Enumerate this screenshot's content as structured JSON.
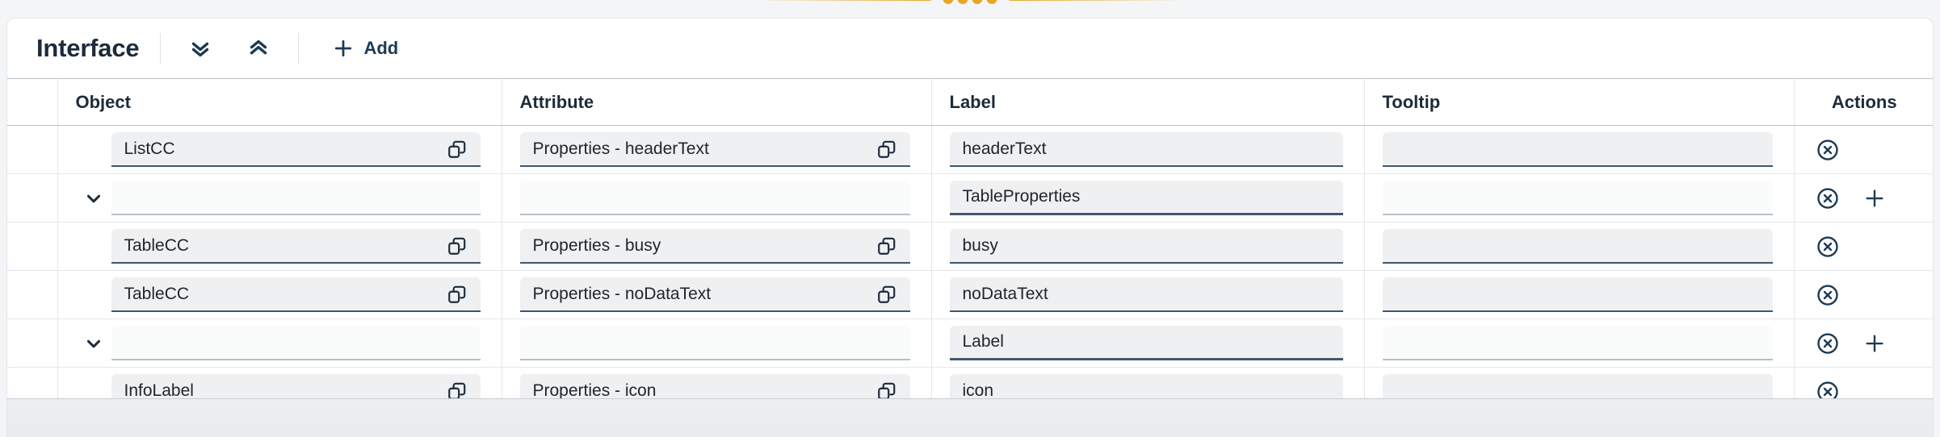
{
  "decoration": {
    "divider_dots": 4,
    "gold_color": "#e8a624"
  },
  "panel": {
    "title": "Interface",
    "toolbar": {
      "expand_all_label": "",
      "collapse_all_label": "",
      "add_label": "Add"
    }
  },
  "table": {
    "columns": [
      "",
      "Object",
      "Attribute",
      "Label",
      "Tooltip",
      "Actions"
    ],
    "rows": [
      {
        "type": "item",
        "object": "ListCC",
        "attribute": "Properties - headerText",
        "label": "headerText",
        "tooltip": "",
        "has_add": false,
        "label_focused": false
      },
      {
        "type": "group",
        "object": "",
        "attribute": "",
        "label": "TableProperties",
        "tooltip": "",
        "has_add": true,
        "label_focused": true
      },
      {
        "type": "item",
        "object": "TableCC",
        "attribute": "Properties - busy",
        "label": "busy",
        "tooltip": "",
        "has_add": false,
        "label_focused": false
      },
      {
        "type": "item",
        "object": "TableCC",
        "attribute": "Properties - noDataText",
        "label": "noDataText",
        "tooltip": "",
        "has_add": false,
        "label_focused": false
      },
      {
        "type": "group",
        "object": "",
        "attribute": "",
        "label": "Label",
        "tooltip": "",
        "has_add": true,
        "label_focused": true
      },
      {
        "type": "item",
        "object": "InfoLabel",
        "attribute": "Properties - icon",
        "label": "icon",
        "tooltip": "",
        "has_add": false,
        "label_focused": false
      }
    ]
  }
}
